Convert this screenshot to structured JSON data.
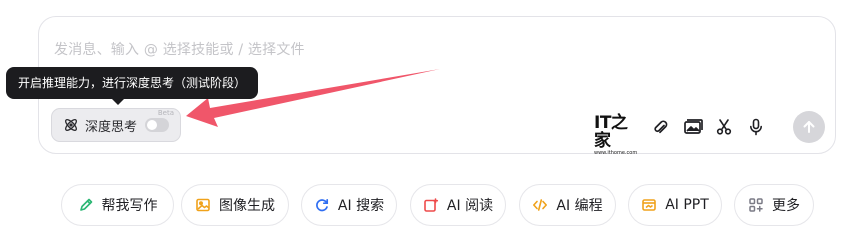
{
  "composer": {
    "placeholder": "发消息、输入 @ 选择技能或 / 选择文件"
  },
  "tooltip": {
    "text": "开启推理能力，进行深度思考（测试阶段）"
  },
  "deep_think": {
    "label": "深度思考",
    "badge": "Beta",
    "enabled": false
  },
  "toolbar": {
    "logo_text": "IT之家",
    "logo_sub": "www.ithome.com",
    "icons": [
      "paperclip-icon",
      "image-gallery-icon",
      "scissors-icon",
      "microphone-icon"
    ],
    "send_icon": "arrow-up-icon"
  },
  "quick_actions": [
    {
      "label": "帮我写作",
      "icon": "pen-icon",
      "color": "#2bb673"
    },
    {
      "label": "图像生成",
      "icon": "image-icon",
      "color": "#f0a21b"
    },
    {
      "label": "AI 搜索",
      "icon": "search-refresh-icon",
      "color": "#2f6ef2"
    },
    {
      "label": "AI 阅读",
      "icon": "reader-icon",
      "color": "#ee4b4b"
    },
    {
      "label": "AI 编程",
      "icon": "code-icon",
      "color": "#f0a21b"
    },
    {
      "label": "AI PPT",
      "icon": "slides-icon",
      "color": "#f0a21b"
    },
    {
      "label": "更多",
      "icon": "grid-icon",
      "color": "#7a7a85"
    }
  ],
  "colors": {
    "annotation_arrow": "#f0566a",
    "tooltip_bg": "#1c1c1f"
  }
}
